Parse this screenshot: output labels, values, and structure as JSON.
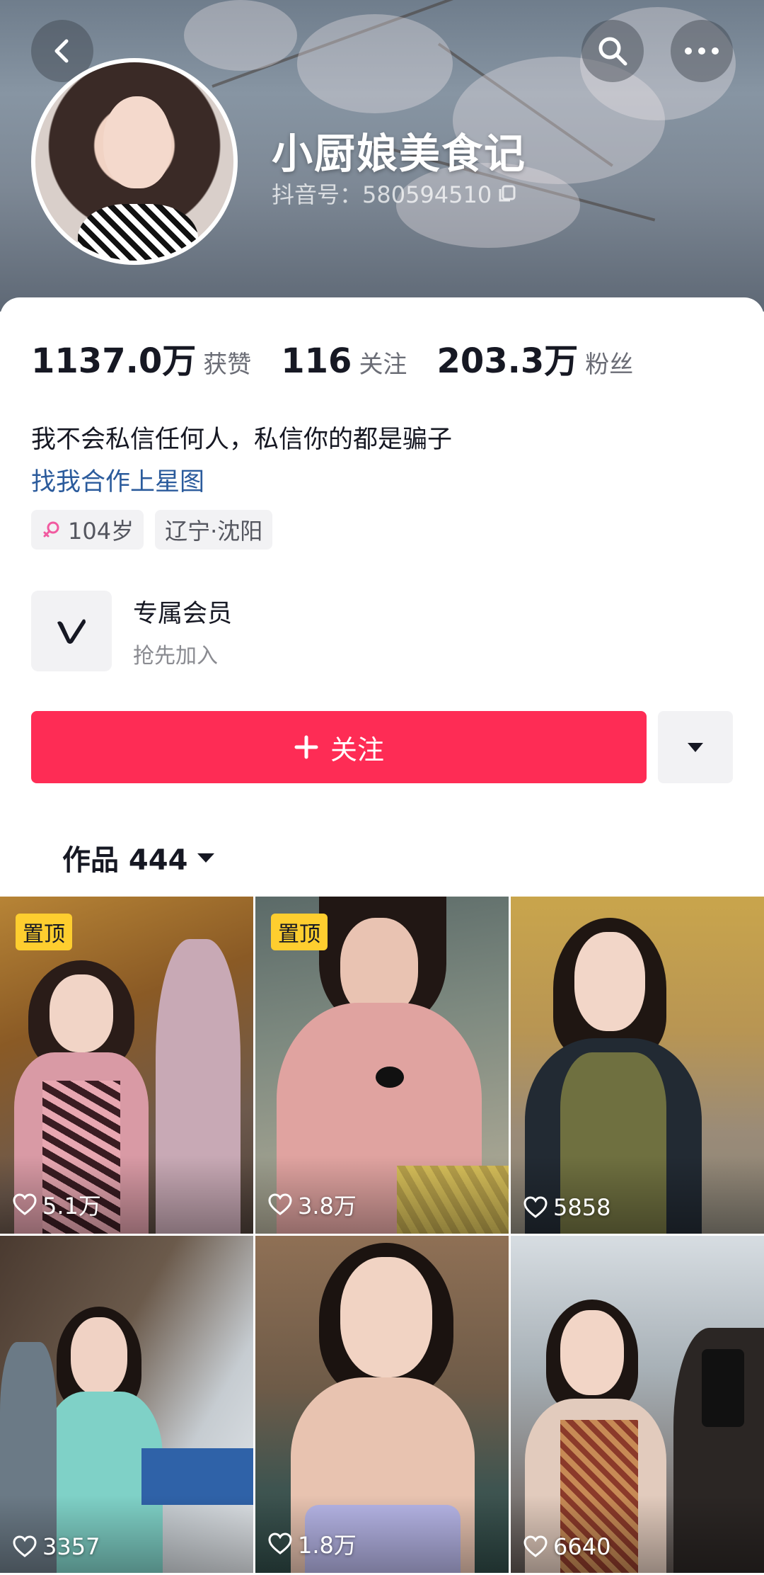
{
  "header": {
    "back_icon": "chevron-left-icon",
    "search_icon": "search-icon",
    "more_icon": "more-dots-icon",
    "name": "小厨娘美食记",
    "douyin_id": "抖音号：580594510"
  },
  "stats": [
    {
      "value": "1137.0万",
      "label": "获赞"
    },
    {
      "value": "116",
      "label": "关注"
    },
    {
      "value": "203.3万",
      "label": "粉丝"
    }
  ],
  "bio": "我不会私信任何人，私信你的都是骗子",
  "link": "找我合作上星图",
  "tags": {
    "age": "104岁",
    "location": "辽宁·沈阳"
  },
  "member": {
    "title": "专属会员",
    "subtitle": "抢先加入"
  },
  "follow_button": "关注",
  "works_tab": "作品 444",
  "videos": [
    {
      "pinned": "置顶",
      "likes": "5.1万"
    },
    {
      "pinned": "置顶",
      "likes": "3.8万"
    },
    {
      "pinned": "",
      "likes": "5858"
    },
    {
      "pinned": "",
      "likes": "3357"
    },
    {
      "pinned": "",
      "likes": "1.8万"
    },
    {
      "pinned": "",
      "likes": "6640"
    }
  ],
  "colors": {
    "accent": "#fe2c55",
    "pin_badge": "#fece2f",
    "link": "#2b5b9c"
  }
}
